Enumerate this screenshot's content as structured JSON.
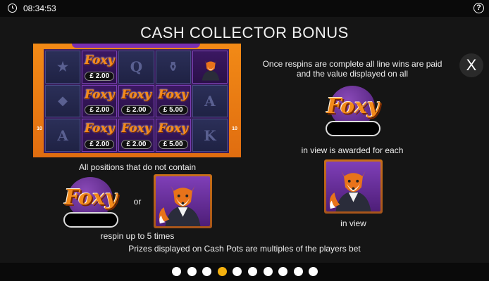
{
  "status_bar": {
    "time": "08:34:53"
  },
  "page": {
    "title": "CASH COLLECTOR BONUS",
    "close_label": "X",
    "help_label": "?"
  },
  "reel": {
    "badge_left": "10",
    "badge_right": "10",
    "rows": [
      [
        {
          "symbol": "foxy-logo-cell"
        },
        {
          "symbol": "foxy",
          "value": "2.00"
        },
        {
          "symbol": "Q"
        },
        {
          "symbol": "bottle"
        },
        {
          "symbol": "fox"
        }
      ],
      [
        {
          "symbol": "diamond"
        },
        {
          "symbol": "foxy",
          "value": "2.00"
        },
        {
          "symbol": "foxy",
          "value": "2.00"
        },
        {
          "symbol": "foxy",
          "value": "5.00"
        },
        {
          "symbol": "A"
        }
      ],
      [
        {
          "symbol": "A"
        },
        {
          "symbol": "foxy",
          "value": "2.00"
        },
        {
          "symbol": "foxy",
          "value": "2.00"
        },
        {
          "symbol": "foxy",
          "value": "5.00"
        },
        {
          "symbol": "K"
        }
      ]
    ],
    "foxy_word": "Foxy",
    "currency": "£"
  },
  "texts": {
    "positions_note": "All positions that do not contain",
    "or_label": "or",
    "respin_note": "respin up to 5 times",
    "prizes_note": "Prizes displayed on Cash Pots are multiples of the players bet",
    "respins_complete": "Once respins are complete all line wins are paid",
    "value_displayed": "and the value displayed on all",
    "awarded_note": "in view is awarded for each",
    "in_view": "in view"
  },
  "logo_word": "Foxy",
  "pagination": {
    "count": 10,
    "active_index": 3
  },
  "colors": {
    "accent_orange": "#f38a1b",
    "purple": "#5a2688",
    "active_dot": "#f5b10f"
  }
}
